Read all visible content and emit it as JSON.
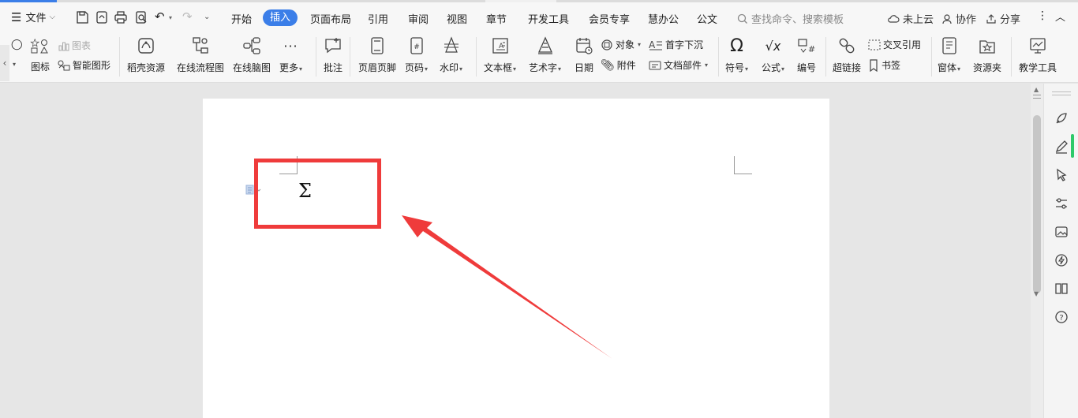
{
  "menubar": {
    "file_label": "文件",
    "tabs": [
      "开始",
      "插入",
      "页面布局",
      "引用",
      "审阅",
      "视图",
      "章节",
      "开发工具",
      "会员专享",
      "慧办公",
      "公文"
    ],
    "active_tab": "插入",
    "search_placeholder": "查找命令、搜索模板",
    "cloud_label": "未上云",
    "collab_label": "协作",
    "share_label": "分享"
  },
  "ribbon": {
    "icon_label": "图标",
    "chart_label": "图表",
    "smartart_label": "智能图形",
    "daoke_label": "稻壳资源",
    "flowchart_label": "在线流程图",
    "mindmap_label": "在线脑图",
    "more_label": "更多",
    "comment_label": "批注",
    "header_footer_label": "页眉页脚",
    "page_number_label": "页码",
    "watermark_label": "水印",
    "textbox_label": "文本框",
    "wordart_label": "艺术字",
    "date_label": "日期",
    "object_label": "对象",
    "attachment_label": "附件",
    "dropcap_label": "首字下沉",
    "docpart_label": "文档部件",
    "symbol_label": "符号",
    "formula_label": "公式",
    "numbering_label": "编号",
    "hyperlink_label": "超链接",
    "crossref_label": "交叉引用",
    "bookmark_label": "书签",
    "window_label": "窗体",
    "resource_label": "资源夹",
    "teaching_label": "教学工具"
  },
  "document": {
    "inserted_symbol": "Σ"
  },
  "colors": {
    "accent": "#3b7ee8",
    "highlight": "#ef3b3b",
    "progress_green": "#2ec96a"
  }
}
